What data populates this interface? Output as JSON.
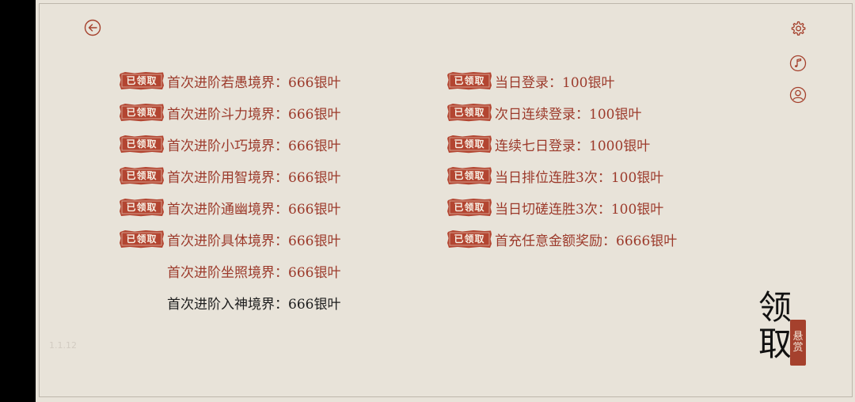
{
  "version": "1.1.12",
  "stamp_label": "已领取",
  "claim_button": {
    "big_chars": [
      "领",
      "取"
    ],
    "seal_text": [
      "悬",
      "赏"
    ]
  },
  "icons": {
    "back": "back-arrow-icon",
    "settings": "gear-icon",
    "music": "music-note-icon",
    "profile": "user-icon"
  },
  "colors": {
    "background": "#e8e3d9",
    "accent": "#9c3a2b",
    "stamp": "#b34531",
    "locked_text": "#1d1d1d"
  },
  "rewards_left": [
    {
      "label": "首次进阶若愚境界：666银叶",
      "status": "claimed"
    },
    {
      "label": "首次进阶斗力境界：666银叶",
      "status": "claimed"
    },
    {
      "label": "首次进阶小巧境界：666银叶",
      "status": "claimed"
    },
    {
      "label": "首次进阶用智境界：666银叶",
      "status": "claimed"
    },
    {
      "label": "首次进阶通幽境界：666银叶",
      "status": "claimed"
    },
    {
      "label": "首次进阶具体境界：666银叶",
      "status": "claimed"
    },
    {
      "label": "首次进阶坐照境界：666银叶",
      "status": "available"
    },
    {
      "label": "首次进阶入神境界：666银叶",
      "status": "locked"
    }
  ],
  "rewards_right": [
    {
      "label": "当日登录：100银叶",
      "status": "claimed"
    },
    {
      "label": "次日连续登录：100银叶",
      "status": "claimed"
    },
    {
      "label": "连续七日登录：1000银叶",
      "status": "claimed"
    },
    {
      "label": "当日排位连胜3次：100银叶",
      "status": "claimed"
    },
    {
      "label": "当日切磋连胜3次：100银叶",
      "status": "claimed"
    },
    {
      "label": "首充任意金额奖励：6666银叶",
      "status": "claimed"
    }
  ]
}
